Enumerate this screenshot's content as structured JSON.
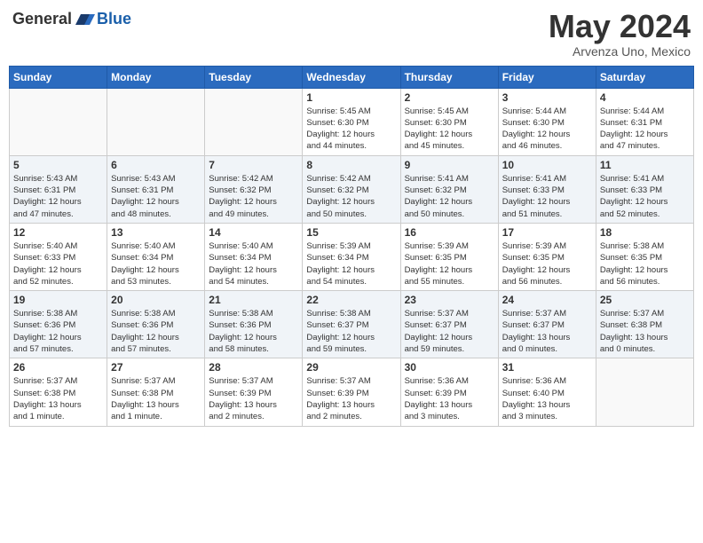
{
  "header": {
    "logo_general": "General",
    "logo_blue": "Blue",
    "title": "May 2024",
    "location": "Arvenza Uno, Mexico"
  },
  "days_of_week": [
    "Sunday",
    "Monday",
    "Tuesday",
    "Wednesday",
    "Thursday",
    "Friday",
    "Saturday"
  ],
  "weeks": [
    {
      "days": [
        {
          "num": "",
          "info": ""
        },
        {
          "num": "",
          "info": ""
        },
        {
          "num": "",
          "info": ""
        },
        {
          "num": "1",
          "info": "Sunrise: 5:45 AM\nSunset: 6:30 PM\nDaylight: 12 hours\nand 44 minutes."
        },
        {
          "num": "2",
          "info": "Sunrise: 5:45 AM\nSunset: 6:30 PM\nDaylight: 12 hours\nand 45 minutes."
        },
        {
          "num": "3",
          "info": "Sunrise: 5:44 AM\nSunset: 6:30 PM\nDaylight: 12 hours\nand 46 minutes."
        },
        {
          "num": "4",
          "info": "Sunrise: 5:44 AM\nSunset: 6:31 PM\nDaylight: 12 hours\nand 47 minutes."
        }
      ]
    },
    {
      "days": [
        {
          "num": "5",
          "info": "Sunrise: 5:43 AM\nSunset: 6:31 PM\nDaylight: 12 hours\nand 47 minutes."
        },
        {
          "num": "6",
          "info": "Sunrise: 5:43 AM\nSunset: 6:31 PM\nDaylight: 12 hours\nand 48 minutes."
        },
        {
          "num": "7",
          "info": "Sunrise: 5:42 AM\nSunset: 6:32 PM\nDaylight: 12 hours\nand 49 minutes."
        },
        {
          "num": "8",
          "info": "Sunrise: 5:42 AM\nSunset: 6:32 PM\nDaylight: 12 hours\nand 50 minutes."
        },
        {
          "num": "9",
          "info": "Sunrise: 5:41 AM\nSunset: 6:32 PM\nDaylight: 12 hours\nand 50 minutes."
        },
        {
          "num": "10",
          "info": "Sunrise: 5:41 AM\nSunset: 6:33 PM\nDaylight: 12 hours\nand 51 minutes."
        },
        {
          "num": "11",
          "info": "Sunrise: 5:41 AM\nSunset: 6:33 PM\nDaylight: 12 hours\nand 52 minutes."
        }
      ]
    },
    {
      "days": [
        {
          "num": "12",
          "info": "Sunrise: 5:40 AM\nSunset: 6:33 PM\nDaylight: 12 hours\nand 52 minutes."
        },
        {
          "num": "13",
          "info": "Sunrise: 5:40 AM\nSunset: 6:34 PM\nDaylight: 12 hours\nand 53 minutes."
        },
        {
          "num": "14",
          "info": "Sunrise: 5:40 AM\nSunset: 6:34 PM\nDaylight: 12 hours\nand 54 minutes."
        },
        {
          "num": "15",
          "info": "Sunrise: 5:39 AM\nSunset: 6:34 PM\nDaylight: 12 hours\nand 54 minutes."
        },
        {
          "num": "16",
          "info": "Sunrise: 5:39 AM\nSunset: 6:35 PM\nDaylight: 12 hours\nand 55 minutes."
        },
        {
          "num": "17",
          "info": "Sunrise: 5:39 AM\nSunset: 6:35 PM\nDaylight: 12 hours\nand 56 minutes."
        },
        {
          "num": "18",
          "info": "Sunrise: 5:38 AM\nSunset: 6:35 PM\nDaylight: 12 hours\nand 56 minutes."
        }
      ]
    },
    {
      "days": [
        {
          "num": "19",
          "info": "Sunrise: 5:38 AM\nSunset: 6:36 PM\nDaylight: 12 hours\nand 57 minutes."
        },
        {
          "num": "20",
          "info": "Sunrise: 5:38 AM\nSunset: 6:36 PM\nDaylight: 12 hours\nand 57 minutes."
        },
        {
          "num": "21",
          "info": "Sunrise: 5:38 AM\nSunset: 6:36 PM\nDaylight: 12 hours\nand 58 minutes."
        },
        {
          "num": "22",
          "info": "Sunrise: 5:38 AM\nSunset: 6:37 PM\nDaylight: 12 hours\nand 59 minutes."
        },
        {
          "num": "23",
          "info": "Sunrise: 5:37 AM\nSunset: 6:37 PM\nDaylight: 12 hours\nand 59 minutes."
        },
        {
          "num": "24",
          "info": "Sunrise: 5:37 AM\nSunset: 6:37 PM\nDaylight: 13 hours\nand 0 minutes."
        },
        {
          "num": "25",
          "info": "Sunrise: 5:37 AM\nSunset: 6:38 PM\nDaylight: 13 hours\nand 0 minutes."
        }
      ]
    },
    {
      "days": [
        {
          "num": "26",
          "info": "Sunrise: 5:37 AM\nSunset: 6:38 PM\nDaylight: 13 hours\nand 1 minute."
        },
        {
          "num": "27",
          "info": "Sunrise: 5:37 AM\nSunset: 6:38 PM\nDaylight: 13 hours\nand 1 minute."
        },
        {
          "num": "28",
          "info": "Sunrise: 5:37 AM\nSunset: 6:39 PM\nDaylight: 13 hours\nand 2 minutes."
        },
        {
          "num": "29",
          "info": "Sunrise: 5:37 AM\nSunset: 6:39 PM\nDaylight: 13 hours\nand 2 minutes."
        },
        {
          "num": "30",
          "info": "Sunrise: 5:36 AM\nSunset: 6:39 PM\nDaylight: 13 hours\nand 3 minutes."
        },
        {
          "num": "31",
          "info": "Sunrise: 5:36 AM\nSunset: 6:40 PM\nDaylight: 13 hours\nand 3 minutes."
        },
        {
          "num": "",
          "info": ""
        }
      ]
    }
  ]
}
